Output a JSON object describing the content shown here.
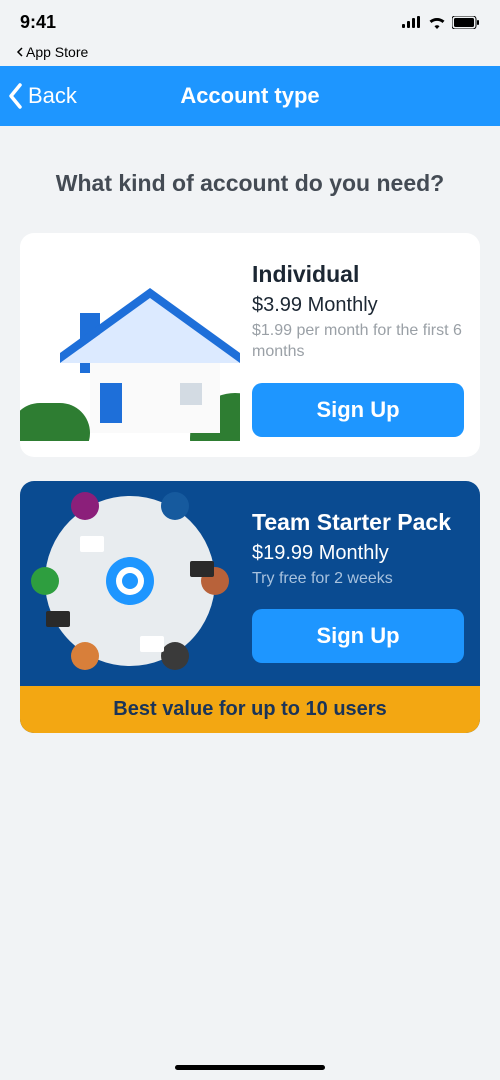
{
  "status": {
    "time": "9:41",
    "breadcrumb": "App Store"
  },
  "nav": {
    "back": "Back",
    "title": "Account type"
  },
  "heading": "What kind of account do you need?",
  "plans": {
    "individual": {
      "title": "Individual",
      "price": "$3.99 Monthly",
      "sub": "$1.99 per month for the first 6 months",
      "cta": "Sign Up"
    },
    "team": {
      "title": "Team Starter Pack",
      "price": "$19.99 Monthly",
      "sub": "Try free for 2 weeks",
      "cta": "Sign Up",
      "banner": "Best value for up to 10 users"
    }
  }
}
